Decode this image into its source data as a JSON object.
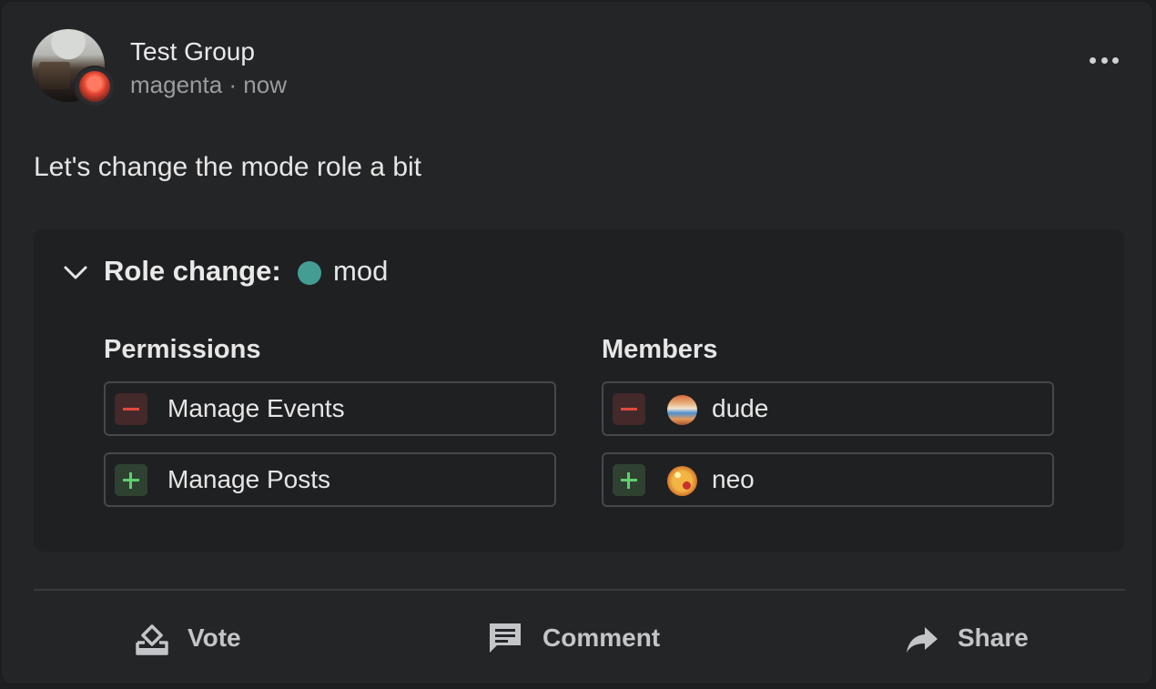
{
  "post": {
    "group_name": "Test Group",
    "meta": "magenta · now",
    "text": "Let's change the mode role a bit"
  },
  "role_change": {
    "title": "Role change:",
    "role_name": "mod",
    "role_color": "#449d92",
    "permissions": {
      "title": "Permissions",
      "items": [
        {
          "change": "remove",
          "label": "Manage Events"
        },
        {
          "change": "add",
          "label": "Manage Posts"
        }
      ]
    },
    "members": {
      "title": "Members",
      "items": [
        {
          "change": "remove",
          "name": "dude"
        },
        {
          "change": "add",
          "name": "neo"
        }
      ]
    }
  },
  "actions": {
    "vote": "Vote",
    "comment": "Comment",
    "share": "Share"
  },
  "icons": {
    "more": "more-horizontal-icon",
    "expand": "chevron-down-icon",
    "vote": "ballot-box-icon",
    "comment": "comment-icon",
    "share": "share-arrow-icon"
  },
  "colors": {
    "remove": "#e0493e",
    "add": "#5fcf6c"
  }
}
